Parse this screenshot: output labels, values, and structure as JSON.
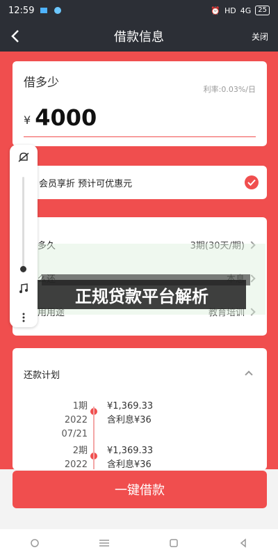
{
  "status_bar": {
    "time": "12:59",
    "network": "HD",
    "signal": "4G",
    "battery": "25"
  },
  "nav": {
    "title": "借款信息",
    "close_label": "关闭"
  },
  "loan": {
    "label": "借多少",
    "rate": "利率:0.03%/日",
    "currency": "¥",
    "amount": "4000"
  },
  "member": {
    "label": "会员享折 预计可优惠元"
  },
  "details": [
    {
      "label": "多久",
      "value": "3期(30天/期)"
    },
    {
      "label": "么还",
      "value": "本息"
    },
    {
      "label": "用用途",
      "value": "教育培训"
    }
  ],
  "plan": {
    "title": "还款计划",
    "items": [
      {
        "period": "1期",
        "year": "2022",
        "date": "07/21",
        "amount": "¥1,369.33",
        "note": "含利息¥36"
      },
      {
        "period": "2期",
        "year": "2022",
        "date": "",
        "amount": "¥1,369.33",
        "note": "含利息¥36"
      }
    ]
  },
  "overlay": {
    "headline": "正规贷款平台解析"
  },
  "cta": {
    "label": "一键借款"
  },
  "colors": {
    "accent": "#f04e4e",
    "dark_bar": "#2c2f36"
  },
  "icons": {
    "back": "back-arrow-icon",
    "check": "check-circle-icon",
    "bell": "bell-icon",
    "music": "music-icon",
    "more": "more-icon"
  }
}
